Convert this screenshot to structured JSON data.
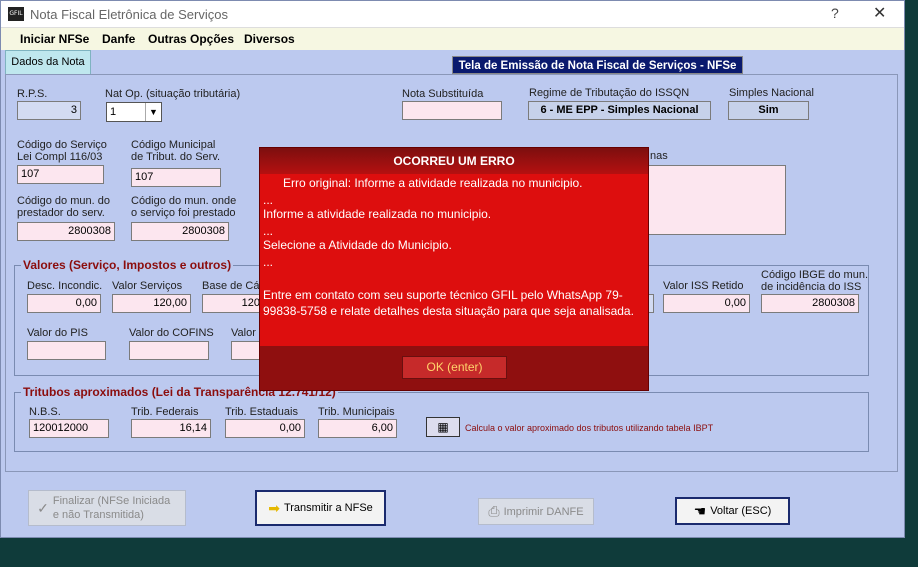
{
  "window": {
    "title": "Nota Fiscal Eletrônica de Serviços",
    "help": "?",
    "close": "✕",
    "icon_text": "GFIL"
  },
  "menu": [
    "Iniciar NFSe",
    "Danfe",
    "Outras Opções",
    "Diversos"
  ],
  "banner": "Tela de Emissão de Nota Fiscal de Serviços  - NFSe",
  "tab": "Dados da Nota",
  "form": {
    "rps_label": "R.P.S.",
    "rps_value": "3",
    "natop_label": "Nat Op. (situação tributária)",
    "natop_value": "1",
    "nota_subst_label": "Nota Substituída",
    "nota_subst_value": "",
    "regime_label": "Regime de Tributação do ISSQN",
    "regime_value": "6 - ME EPP - Simples Nacional",
    "simples_label": "Simples Nacional",
    "simples_value": "Sim",
    "cod_servico_label1": "Código do Serviço",
    "cod_servico_label2": "Lei Compl 116/03",
    "cod_servico_value": "107",
    "cod_municipal_label1": "Código Municipal",
    "cod_municipal_label2": "de Tribut. do Serv.",
    "cod_municipal_value": "107",
    "obs_label_tail": "nas",
    "mun_prest_label1": "Código do mun. do",
    "mun_prest_label2": "prestador do serv.",
    "mun_prest_value": "2800308",
    "mun_onde_label1": "Código do mun. onde",
    "mun_onde_label2": "o serviço foi prestado",
    "mun_onde_value": "2800308",
    "valores_legend": "Valores (Serviço, Impostos e outros)",
    "desc_incond_label": "Desc. Incondic.",
    "desc_incond_value": "0,00",
    "valor_servicos_label": "Valor Serviços",
    "valor_servicos_value": "120,00",
    "base_calc_label": "Base de Cál",
    "base_calc_value": "120",
    "iss_retido_label": "Valor ISS Retido",
    "iss_retido_value": "0,00",
    "ibge_label1": "Código IBGE do mun.",
    "ibge_label2": "de incidência do ISS",
    "ibge_value": "2800308",
    "pis_label": "Valor do PIS",
    "pis_value": "",
    "cofins_label": "Valor do COFINS",
    "cofins_value": "",
    "valor_other_label": "Valor",
    "tributos_legend": "Tritubos aproximados (Lei da Transparência 12.741/12)",
    "nbs_label": "N.B.S.",
    "nbs_value": "120012000",
    "trib_fed_label": "Trib. Federais",
    "trib_fed_value": "16,14",
    "trib_est_label": "Trib. Estaduais",
    "trib_est_value": "0,00",
    "trib_mun_label": "Trib. Municipais",
    "trib_mun_value": "6,00",
    "calc_text": "Calcula o valor aproximado dos tributos utilizando tabela IBPT"
  },
  "buttons": {
    "finalizar": "Finalizar (NFSe Iniciada e não Transmitida)",
    "transmitir": "Transmitir a NFSe",
    "imprimir": "Imprimir DANFE",
    "voltar": "Voltar (ESC)"
  },
  "dialog": {
    "title": "OCORREU UM ERRO",
    "line1": "      Erro original: Informe a atividade realizada no municipio.",
    "line2": "...",
    "line3": "Informe a atividade realizada no municipio.",
    "line4": "...",
    "line5": "Selecione a Atividade do Municipio.",
    "line6": "...",
    "message": "Entre em contato com seu suporte técnico GFIL pelo WhatsApp 79-99838-5758 e relate detalhes desta situação para que seja analisada.",
    "ok": "OK (enter)"
  }
}
